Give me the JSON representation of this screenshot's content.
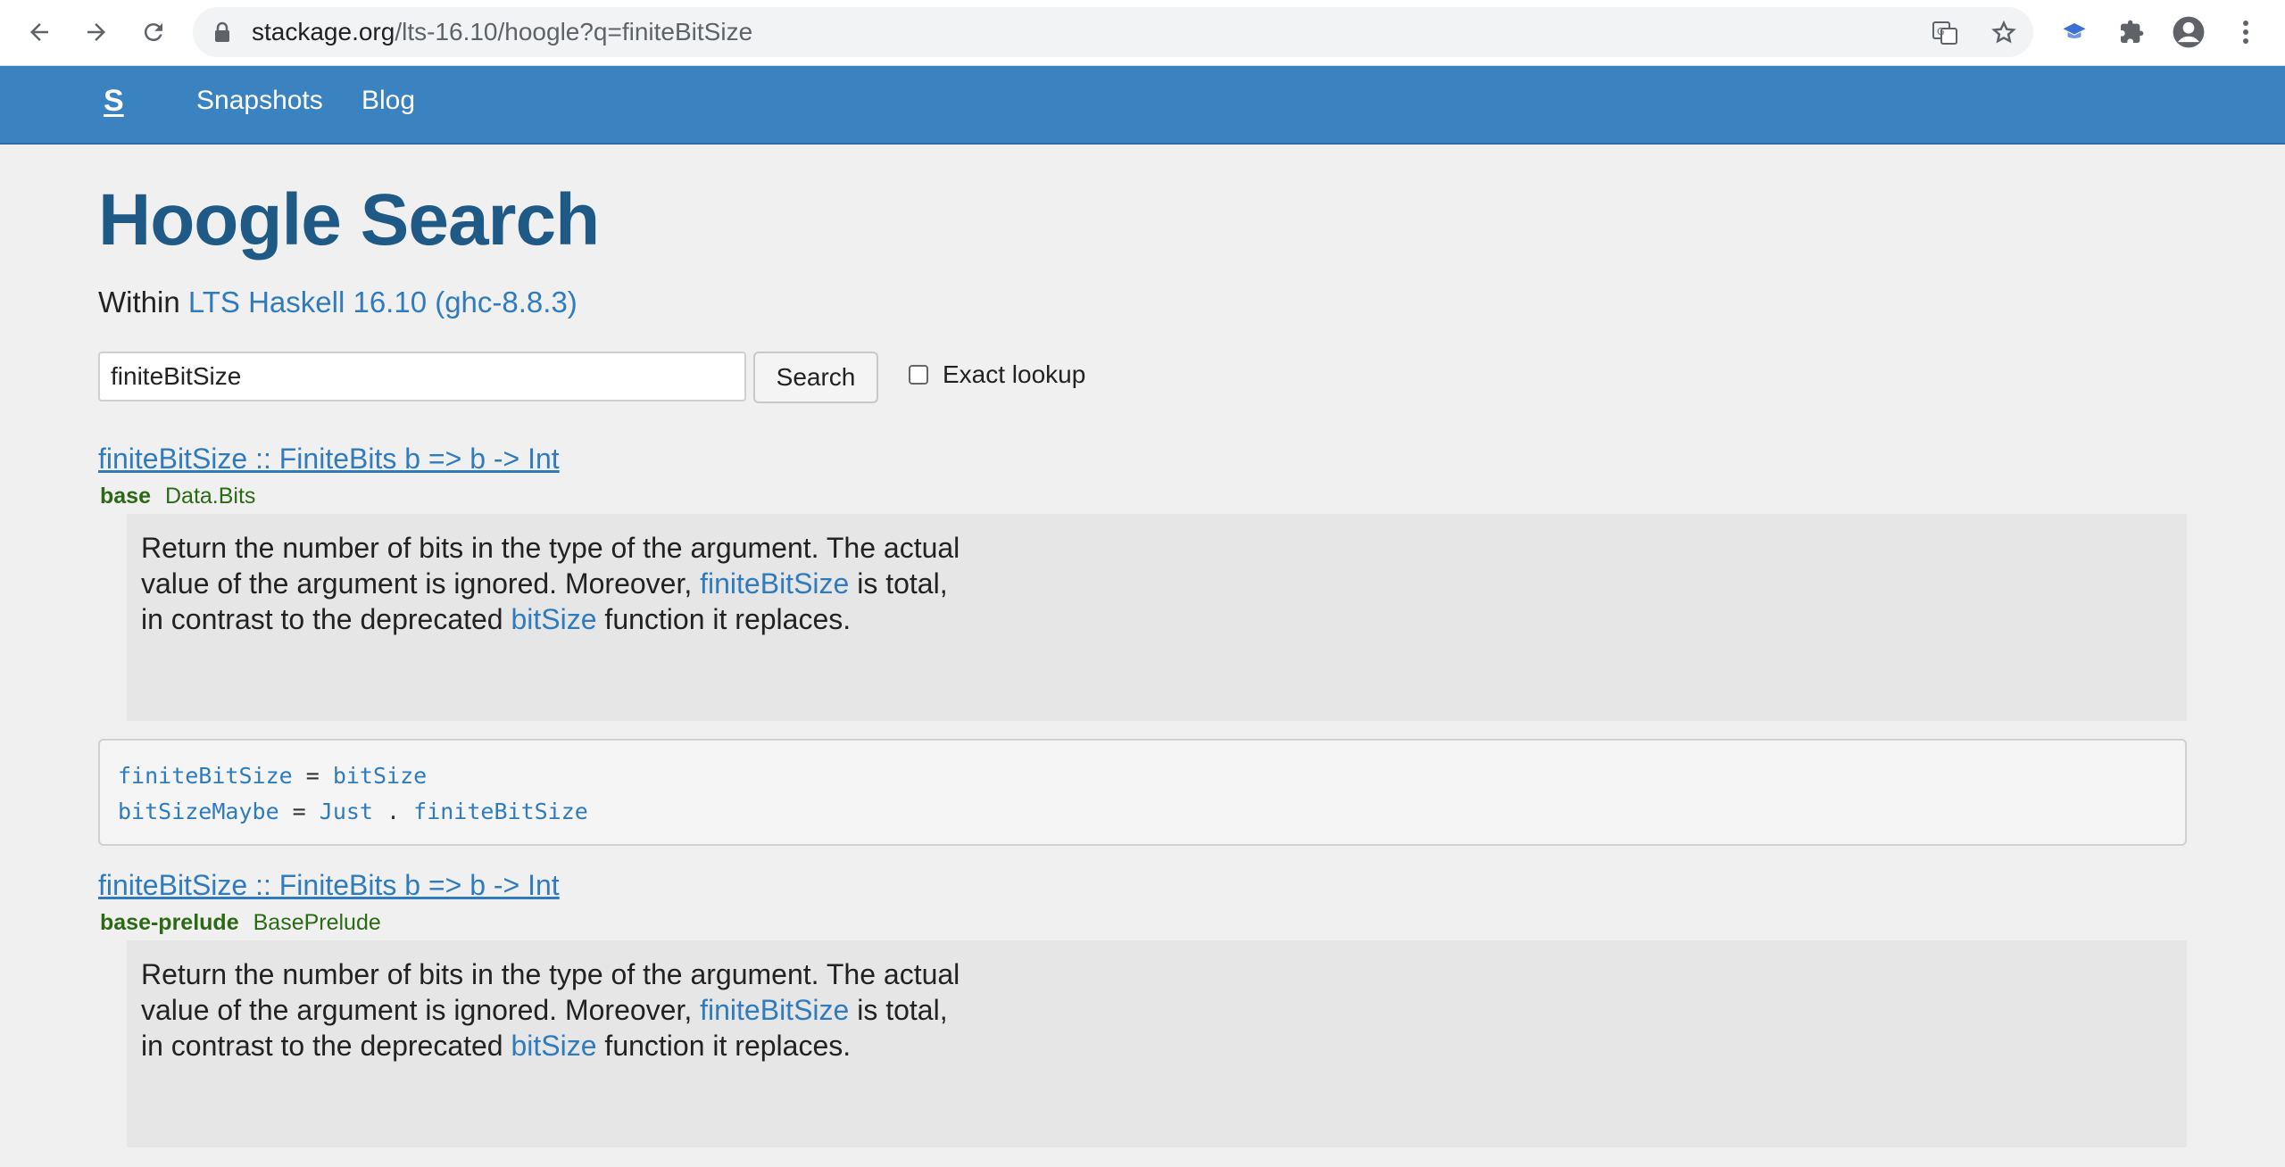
{
  "browser": {
    "url_host": "stackage.org",
    "url_path": "/lts-16.10/hoogle?q=finiteBitSize"
  },
  "sitenav": {
    "brand": "S",
    "links": [
      "Snapshots",
      "Blog"
    ]
  },
  "page": {
    "title": "Hoogle Search",
    "within_prefix": "Within",
    "within_link": "LTS Haskell 16.10 (ghc-8.8.3)"
  },
  "search": {
    "value": "finiteBitSize",
    "button_label": "Search",
    "exact_label": "Exact lookup",
    "exact_checked": false
  },
  "results": [
    {
      "signature": "finiteBitSize :: FiniteBits b => b -> Int",
      "package": "base",
      "module": "Data.Bits",
      "doc": {
        "p1": "Return the number of bits in the type of the argument. The actual value of the argument is ignored. Moreover, ",
        "link1": "finiteBitSize",
        "p2": " is total, in contrast to the deprecated ",
        "link2": "bitSize",
        "p3": " function it replaces."
      }
    },
    {
      "signature": "finiteBitSize :: FiniteBits b => b -> Int",
      "package": "base-prelude",
      "module": "BasePrelude",
      "doc": {
        "p1": "Return the number of bits in the type of the argument. The actual value of the argument is ignored. Moreover, ",
        "link1": "finiteBitSize",
        "p2": " is total, in contrast to the deprecated ",
        "link2": "bitSize",
        "p3": " function it replaces."
      }
    }
  ],
  "code_example": {
    "line1": {
      "lhs": "finiteBitSize",
      "eq": " = ",
      "rhs": "bitSize"
    },
    "line2": {
      "lhs": "bitSizeMaybe",
      "eq": " = ",
      "rhs1": "Just",
      "dot": " . ",
      "rhs2": "finiteBitSize"
    }
  }
}
